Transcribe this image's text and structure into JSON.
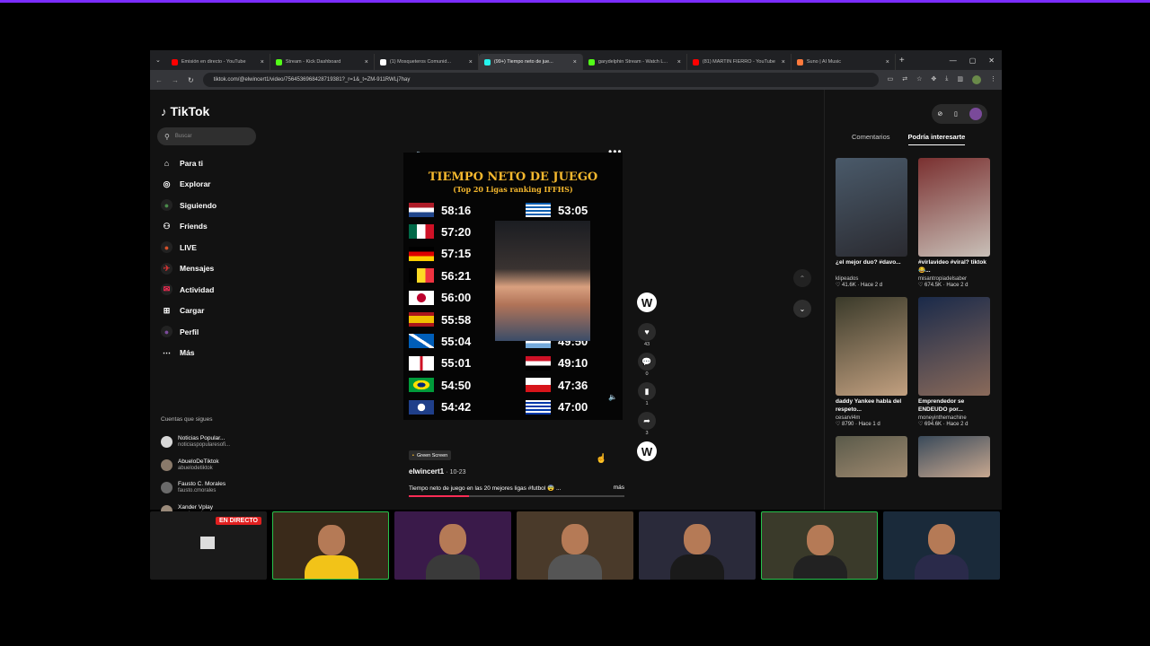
{
  "browser": {
    "tabs": [
      {
        "label": "Emisión en directo - YouTube",
        "fav": "#ff0000",
        "active": false
      },
      {
        "label": "Stream - Kick Dashboard",
        "fav": "#53fc18",
        "active": false
      },
      {
        "label": "(1) Mosqueteros Comunid...",
        "fav": "#ffffff",
        "active": false
      },
      {
        "label": "(99+) Tiempo neto de jue...",
        "fav": "#25f4ee",
        "active": true
      },
      {
        "label": "garydelphin Stream - Watch L...",
        "fav": "#53fc18",
        "active": false
      },
      {
        "label": "(81) MARTIN FIERRO - YouTube",
        "fav": "#ff0000",
        "active": false
      },
      {
        "label": "Suno | AI Music",
        "fav": "#ff7a3c",
        "active": false
      }
    ],
    "new_tab": "+",
    "url": "tiktok.com/@elwincert1/video/7564536968428719381?_r=1&_t=ZM-911RWLj7hay"
  },
  "tiktok": {
    "logo": "TikTok",
    "search_placeholder": "Buscar",
    "nav": [
      {
        "label": "Para ti",
        "icon": "home-icon"
      },
      {
        "label": "Explorar",
        "icon": "compass-icon"
      },
      {
        "label": "Siguiendo",
        "icon": "following-icon"
      },
      {
        "label": "Friends",
        "icon": "friends-icon"
      },
      {
        "label": "LIVE",
        "icon": "live-icon"
      },
      {
        "label": "Mensajes",
        "icon": "messages-icon"
      },
      {
        "label": "Actividad",
        "icon": "activity-icon"
      },
      {
        "label": "Cargar",
        "icon": "upload-icon"
      },
      {
        "label": "Perfil",
        "icon": "profile-icon"
      },
      {
        "label": "Más",
        "icon": "more-icon"
      }
    ],
    "following_title": "Cuentas que sigues",
    "following": [
      {
        "name": "Noticias Popular...",
        "handle": "noticiaspopularesofi..."
      },
      {
        "name": "AbueloDeTiktok",
        "handle": "abuelodetiktok"
      },
      {
        "name": "Fausto C. Morales",
        "handle": "fausto.cmorales"
      },
      {
        "name": "Xander Vplay",
        "handle": "xander.vplay"
      },
      {
        "name": "Miguel Navarro06",
        "handle": "migelito.06"
      }
    ]
  },
  "video": {
    "title": "TIEMPO NETO DE JUEGO",
    "subtitle": "(Top 20 Ligas ranking IFFHS)",
    "left_col": [
      {
        "time": "58:16",
        "flag": "netherlands"
      },
      {
        "time": "57:20",
        "flag": "mexico"
      },
      {
        "time": "57:15",
        "flag": "germany"
      },
      {
        "time": "56:21",
        "flag": "belgium"
      },
      {
        "time": "56:00",
        "flag": "japan"
      },
      {
        "time": "55:58",
        "flag": "spain"
      },
      {
        "time": "55:04",
        "flag": "scotland"
      },
      {
        "time": "55:01",
        "flag": "england"
      },
      {
        "time": "54:50",
        "flag": "brazil"
      },
      {
        "time": "54:42",
        "flag": "saudi"
      }
    ],
    "right_col": [
      {
        "time": "53:05",
        "flag": "greece"
      },
      {
        "time": ":45",
        "flag": "hidden"
      },
      {
        "time": ":53",
        "flag": "hidden"
      },
      {
        "time": ":30",
        "flag": "hidden"
      },
      {
        "time": ":14",
        "flag": "hidden"
      },
      {
        "time": "",
        "flag": "hidden"
      },
      {
        "time": "49:50",
        "flag": "argentina"
      },
      {
        "time": "49:10",
        "flag": "egypt"
      },
      {
        "time": "47:36",
        "flag": "czech"
      },
      {
        "time": "47:00",
        "flag": "uruguay"
      }
    ],
    "likes": "43",
    "comments": "0",
    "saves": "1",
    "shares": "3",
    "badge": "Green Screen",
    "author": "elwincert1",
    "date": "· 10-23",
    "caption": "Tiempo neto de juego en las 20 mejores ligas #futbol 😨 ...",
    "more": "más",
    "progress": 0.28
  },
  "right_panel": {
    "tabs": [
      "Comentarios",
      "Podría interesarte"
    ],
    "active_tab": 1,
    "cards": [
      {
        "title": "¿el mejor duo? #davo...",
        "user": "klipeados",
        "meta": "♡ 41.6K · Hace 2 d",
        "colors": [
          "#4a5a6a",
          "#2a2a30"
        ]
      },
      {
        "title": "#virlavideo #viral? tiktok 😂...",
        "user": "misantropiadelsaber",
        "meta": "♡ 674.5K · Hace 2 d",
        "colors": [
          "#7a3030",
          "#c9c0b8"
        ]
      },
      {
        "title": "daddy Yankee habla del respeto...",
        "user": "cesarvl4m",
        "meta": "♡ 8790 · Hace 1 d",
        "colors": [
          "#3a3a2a",
          "#c2a080"
        ]
      },
      {
        "title": "Emprendedor se ENDEUDO por...",
        "user": "moneyinthemachine",
        "meta": "♡ 694.6K · Hace 2 d",
        "colors": [
          "#1a2a4a",
          "#8a6a5a"
        ]
      },
      {
        "title": "",
        "user": "",
        "meta": "",
        "colors": [
          "#5a5a4a",
          "#a08a70"
        ]
      },
      {
        "title": "",
        "user": "",
        "meta": "",
        "colors": [
          "#3a4a5a",
          "#c8a890"
        ]
      }
    ]
  },
  "cams": {
    "live_label": "EN DIRECTO"
  }
}
